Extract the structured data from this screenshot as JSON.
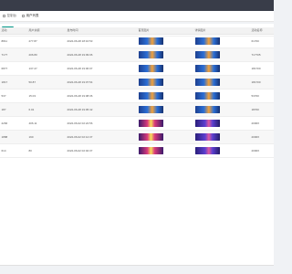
{
  "tabs": [
    {
      "label": "控制台",
      "icon": "home-icon"
    },
    {
      "label": "用户列表",
      "icon": "list-icon"
    }
  ],
  "toolbar": {
    "add_label": "1.Add"
  },
  "table": {
    "headers": [
      "活动",
      "用户余额",
      "发布时间",
      "首页图片",
      "详情图片",
      "活动名称"
    ],
    "rows": [
      {
        "c1": "8811",
        "c2": "277.87",
        "c3": "2022-06-28 18:16:53",
        "img1": "blue",
        "img2": "blue",
        "c6": "61700"
      },
      {
        "c1": "7177",
        "c2": "206.80",
        "c3": "2022-06-28 19:09:06",
        "img1": "blue",
        "img2": "blue",
        "c6": "717705"
      },
      {
        "c1": "6877",
        "c2": "137.27",
        "c3": "2022-06-28 19:06:07",
        "img1": "blue",
        "img2": "blue",
        "c6": "181700"
      },
      {
        "c1": "1817",
        "c2": "50.87",
        "c3": "2022-06-28 19:07:54",
        "img1": "blue",
        "img2": "blue",
        "c6": "181700"
      },
      {
        "c1": "537",
        "c2": "15.03",
        "c3": "2022-06-28 19:08:36",
        "img1": "blue",
        "img2": "blue",
        "c6": "53700"
      },
      {
        "c1": "187",
        "c2": "6.01",
        "c3": "2022-06-28 19:05:42",
        "img1": "blue",
        "img2": "blue",
        "c6": "18700"
      },
      {
        "c1": "2266",
        "c2": "406.11",
        "c3": "2022-06-02 02:22:56",
        "img1": "pink",
        "img2": "purple",
        "c6": "2000X"
      },
      {
        "c1": "1888",
        "c2": "190",
        "c3": "2022-06-02 02:12:37",
        "img1": "pink",
        "img2": "purple",
        "c6": "2000X"
      },
      {
        "c1": "614",
        "c2": "80",
        "c3": "2022-06-02 02:02:37",
        "img1": "pink",
        "img2": "purple",
        "c6": "2000X"
      }
    ]
  }
}
